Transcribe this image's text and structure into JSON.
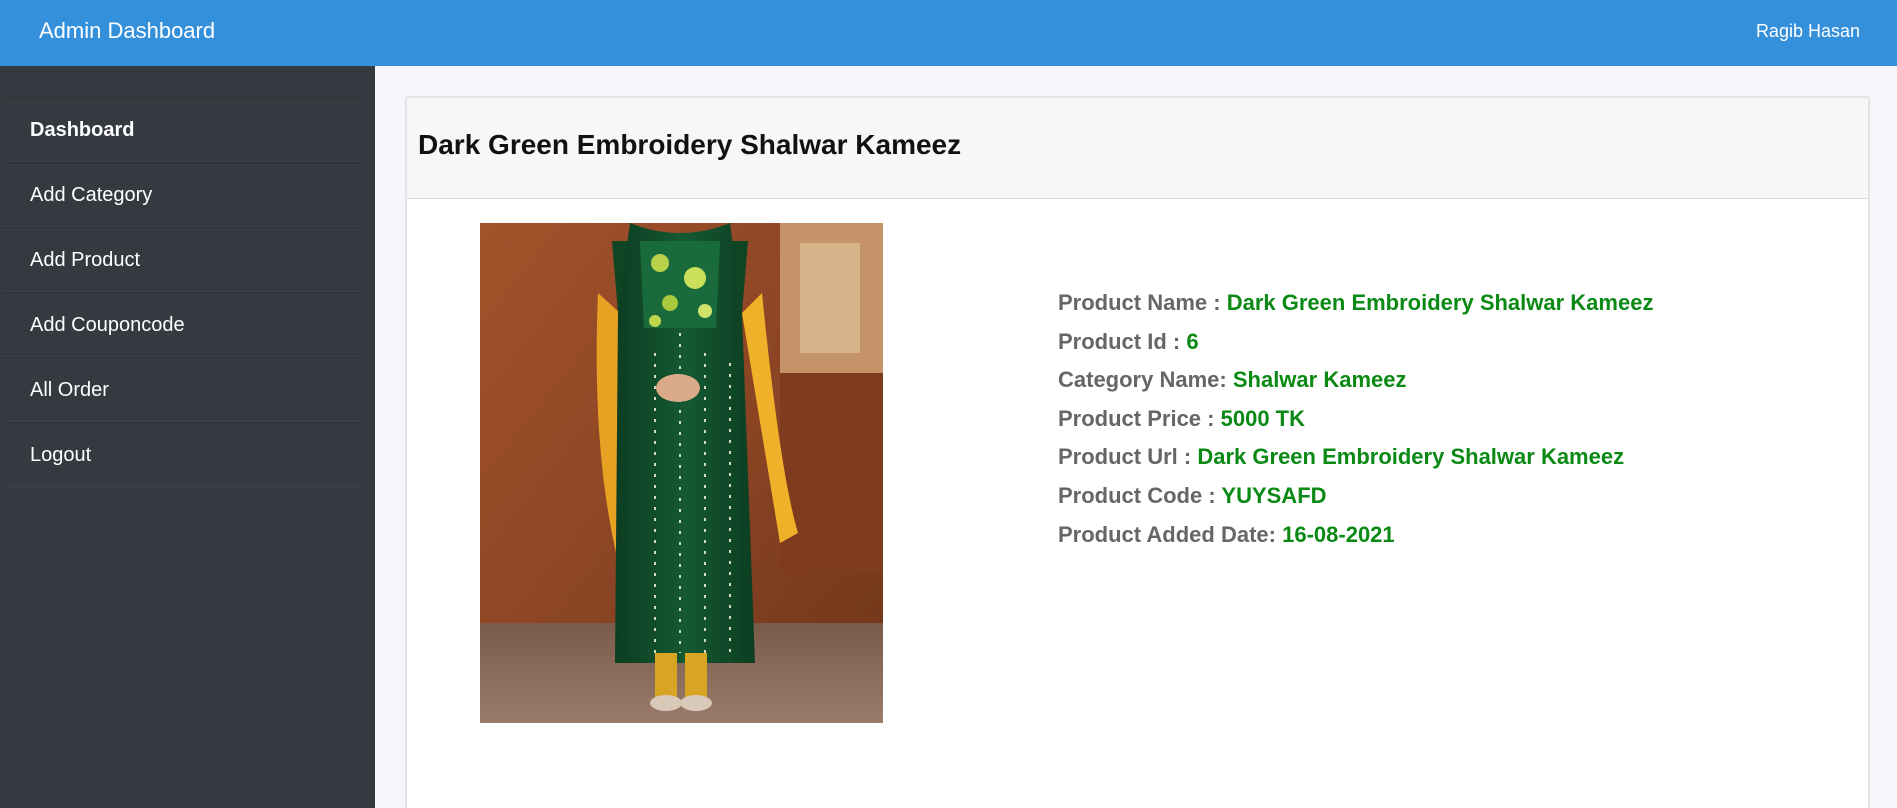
{
  "header": {
    "title": "Admin Dashboard",
    "user": "Ragib Hasan"
  },
  "sidebar": {
    "items": [
      {
        "label": "Dashboard"
      },
      {
        "label": "Add Category"
      },
      {
        "label": "Add Product"
      },
      {
        "label": "Add Couponcode"
      },
      {
        "label": "All Order"
      },
      {
        "label": "Logout"
      }
    ]
  },
  "product": {
    "title": "Dark Green Embroidery Shalwar Kameez",
    "fields": [
      {
        "label": "Product Name :",
        "value": "Dark Green Embroidery Shalwar Kameez"
      },
      {
        "label": "Product Id :",
        "value": "6"
      },
      {
        "label": "Category Name:",
        "value": "Shalwar Kameez"
      },
      {
        "label": "Product Price :",
        "value": "5000 TK"
      },
      {
        "label": "Product Url :",
        "value": "Dark Green Embroidery Shalwar Kameez"
      },
      {
        "label": "Product Code :",
        "value": "YUYSAFD"
      },
      {
        "label": "Product Added Date:",
        "value": "16-08-2021"
      }
    ]
  },
  "colors": {
    "topbar": "#3590dc",
    "sidebar": "#343a40",
    "value_text": "#0a8a14",
    "label_text": "#666666"
  }
}
